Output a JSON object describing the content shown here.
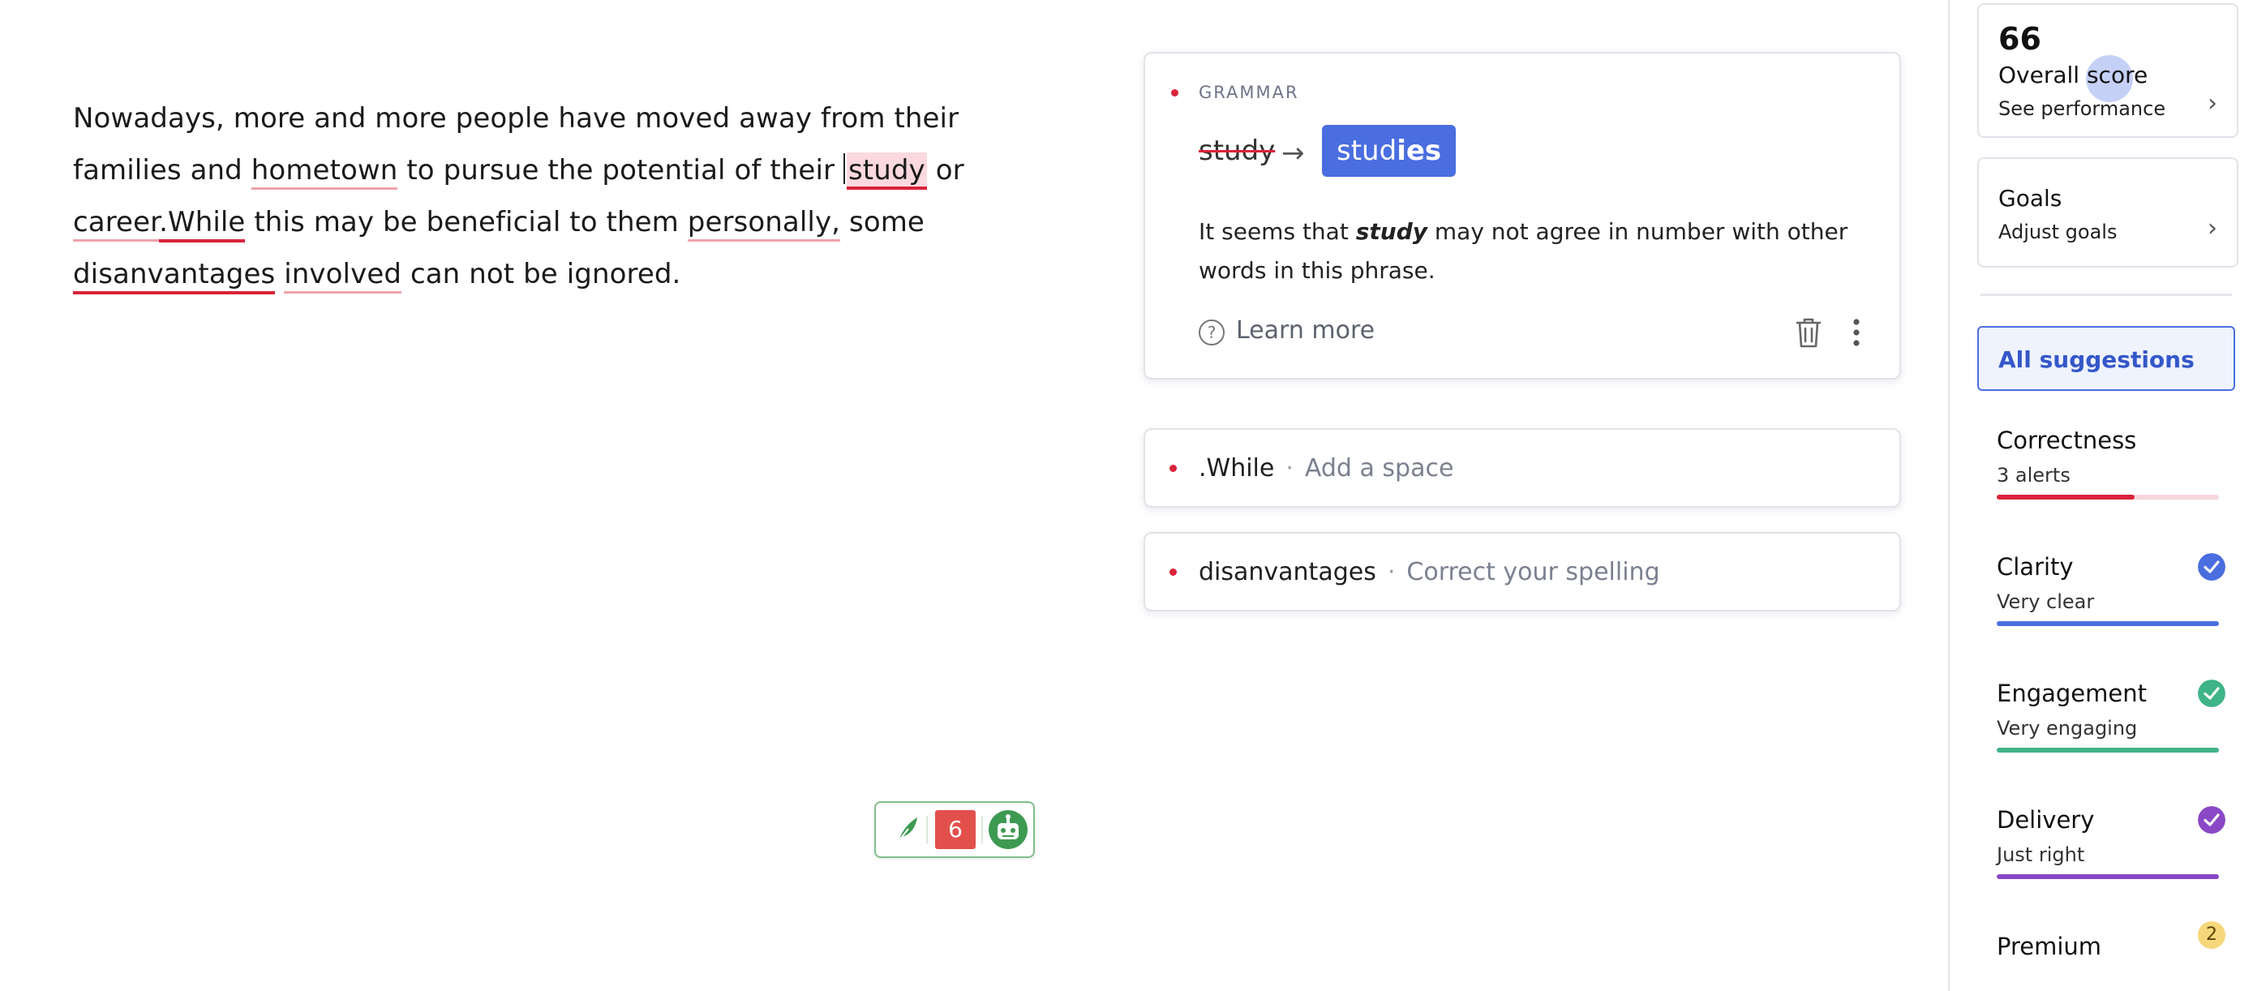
{
  "editor": {
    "segments": [
      {
        "t": "Nowadays, more and more people have moved away from their families and ",
        "s": ""
      },
      {
        "t": "hometown",
        "s": "ul-light"
      },
      {
        "t": " to pursue the potential of their ",
        "s": ""
      },
      {
        "t": "study",
        "s": "hl ul-strong",
        "caret": true
      },
      {
        "t": " or ",
        "s": ""
      },
      {
        "t": "career",
        "s": "ul-light"
      },
      {
        "t": ".While",
        "s": "ul-strong"
      },
      {
        "t": " this may be beneficial to them ",
        "s": ""
      },
      {
        "t": "personally,",
        "s": "ul-light"
      },
      {
        "t": " some ",
        "s": ""
      },
      {
        "t": "disanvantages",
        "s": "ul-strong"
      },
      {
        "t": " ",
        "s": ""
      },
      {
        "t": "involved",
        "s": "ul-light"
      },
      {
        "t": " can not be ignored.",
        "s": ""
      }
    ]
  },
  "suggestion_card": {
    "category": "GRAMMAR",
    "old_word": "study",
    "arrow": "→",
    "replacement_base": "stud",
    "replacement_bold": "ies",
    "explanation_before": "It seems that ",
    "explanation_term": "study",
    "explanation_after": " may not agree in number with other words in this phrase.",
    "help_glyph": "?",
    "learn_more": "Learn more"
  },
  "alerts": [
    {
      "word": ".While",
      "separator": "·",
      "desc": "Add a space"
    },
    {
      "word": "disanvantages",
      "separator": "·",
      "desc": "Correct your spelling"
    }
  ],
  "widget": {
    "count": "6"
  },
  "sidebar": {
    "score": {
      "value": "66",
      "title": "Overall score",
      "link": "See performance"
    },
    "goals": {
      "title": "Goals",
      "link": "Adjust goals"
    },
    "chevron": "›",
    "all_suggestions": "All suggestions",
    "categories": [
      {
        "title": "Correctness",
        "sub": "3 alerts",
        "color": "#d9233b",
        "progress": 0.62
      },
      {
        "title": "Clarity",
        "sub": "Very clear",
        "color": "#4a6ee0"
      },
      {
        "title": "Engagement",
        "sub": "Very engaging",
        "color": "#3fb489"
      },
      {
        "title": "Delivery",
        "sub": "Just right",
        "color": "#8a48c6"
      },
      {
        "title": "Premium",
        "badge": "2"
      }
    ]
  }
}
